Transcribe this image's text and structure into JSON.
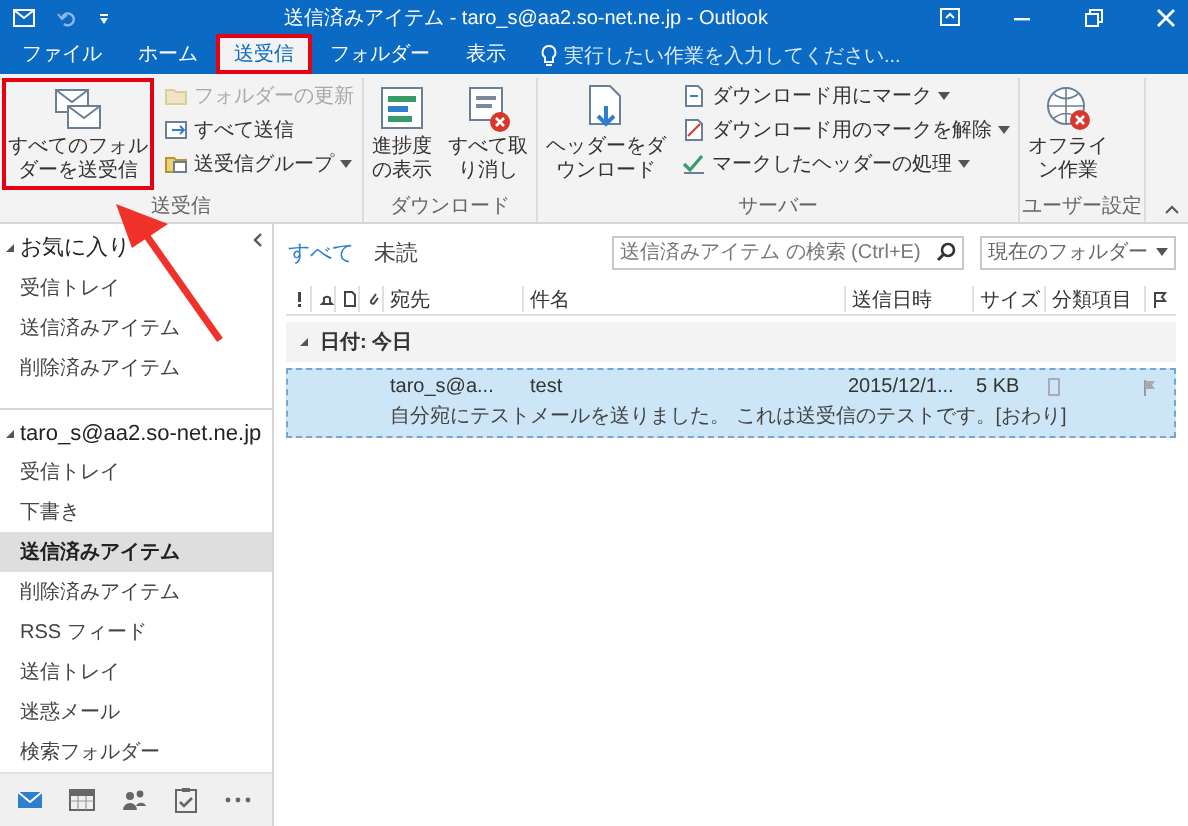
{
  "window": {
    "title": "送信済みアイテム - taro_s@aa2.so-net.ne.jp - Outlook"
  },
  "tabs": [
    {
      "label": "ファイル",
      "selected": false,
      "highlighted": false
    },
    {
      "label": "ホーム",
      "selected": false,
      "highlighted": false
    },
    {
      "label": "送受信",
      "selected": true,
      "highlighted": true
    },
    {
      "label": "フォルダー",
      "selected": false,
      "highlighted": false
    },
    {
      "label": "表示",
      "selected": false,
      "highlighted": false
    }
  ],
  "tell_me": {
    "placeholder": "実行したい作業を入力してください..."
  },
  "ribbon": {
    "groups": [
      {
        "label": "送受信",
        "buttons": [
          {
            "kind": "large",
            "label": "すべてのフォルダーを送受信",
            "highlighted": true,
            "disabled": false
          },
          {
            "kind": "small",
            "label": "フォルダーの更新",
            "highlighted": false,
            "disabled": true
          },
          {
            "kind": "small",
            "label": "すべて送信",
            "highlighted": false,
            "disabled": false
          },
          {
            "kind": "small",
            "label": "送受信グループ",
            "highlighted": false,
            "disabled": false,
            "dropdown": true
          }
        ]
      },
      {
        "label": "ダウンロード",
        "buttons": [
          {
            "kind": "large",
            "label": "進捗度の表示",
            "highlighted": false,
            "disabled": false
          },
          {
            "kind": "large",
            "label": "すべて取り消し",
            "highlighted": false,
            "disabled": false
          }
        ]
      },
      {
        "label": "サーバー",
        "buttons": [
          {
            "kind": "large",
            "label": "ヘッダーをダウンロード",
            "highlighted": false,
            "disabled": false
          },
          {
            "kind": "small",
            "label": "ダウンロード用にマーク",
            "highlighted": false,
            "disabled": false,
            "dropdown": true
          },
          {
            "kind": "small",
            "label": "ダウンロード用のマークを解除",
            "highlighted": false,
            "disabled": false,
            "dropdown": true
          },
          {
            "kind": "small",
            "label": "マークしたヘッダーの処理",
            "highlighted": false,
            "disabled": false,
            "dropdown": true
          }
        ]
      },
      {
        "label": "ユーザー設定",
        "buttons": [
          {
            "kind": "large",
            "label": "オフライン作業",
            "highlighted": false,
            "disabled": false
          }
        ]
      }
    ]
  },
  "sidebar": {
    "sections": [
      {
        "label": "お気に入り",
        "expanded": true,
        "children": [
          {
            "label": "受信トレイ",
            "selected": false
          },
          {
            "label": "送信済みアイテム",
            "selected": false
          },
          {
            "label": "削除済みアイテム",
            "selected": false
          }
        ]
      },
      {
        "label": "taro_s@aa2.so-net.ne.jp",
        "expanded": true,
        "children": [
          {
            "label": "受信トレイ",
            "selected": false
          },
          {
            "label": "下書き",
            "selected": false
          },
          {
            "label": "送信済みアイテム",
            "selected": true
          },
          {
            "label": "削除済みアイテム",
            "selected": false
          },
          {
            "label": "RSS フィード",
            "selected": false
          },
          {
            "label": "送信トレイ",
            "selected": false
          },
          {
            "label": "迷惑メール",
            "selected": false
          },
          {
            "label": "検索フォルダー",
            "selected": false
          }
        ]
      }
    ]
  },
  "nav_bar": {
    "items": [
      {
        "selected": true
      },
      {
        "selected": false
      },
      {
        "selected": false
      },
      {
        "selected": false
      },
      {
        "selected": false
      }
    ]
  },
  "filters": [
    {
      "label": "すべて",
      "selected": true
    },
    {
      "label": "未読",
      "selected": false
    }
  ],
  "search": {
    "placeholder": "送信済みアイテム の検索 (Ctrl+E)",
    "scope": "現在のフォルダー"
  },
  "table": {
    "columns": [
      "宛先",
      "件名",
      "送信日時",
      "サイズ",
      "分類項目"
    ],
    "groups": [
      {
        "label": "日付: 今日",
        "expanded": true,
        "rows": [
          {
            "to": "taro_s@a...",
            "subject": "test",
            "sent": "2015/12/1...",
            "size": "5 KB",
            "preview": "自分宛にテストメールを送りました。 これは送受信のテストです。[おわり]",
            "selected": true
          }
        ]
      }
    ]
  },
  "annotation_arrow": true
}
